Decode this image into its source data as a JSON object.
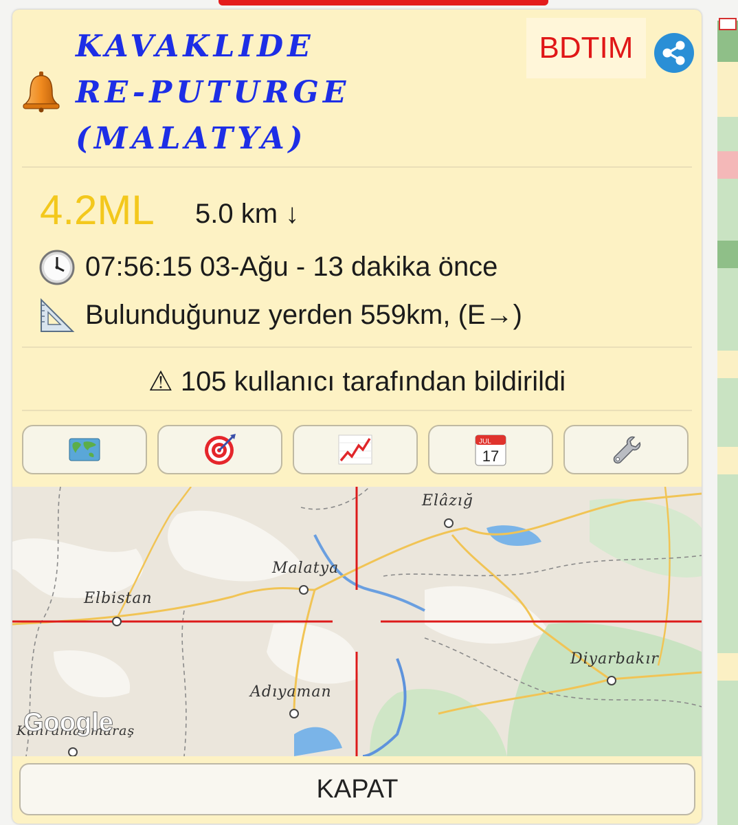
{
  "event": {
    "title_lines": [
      "KAVAKLIDE",
      "RE-PUTURGE",
      "(MALATYA)"
    ],
    "source": "BDTIM",
    "magnitude": "4.2ML",
    "depth": "5.0 km ↓",
    "time": "07:56:15 03-Ağu - 13 dakika önce",
    "distance": "Bulunduğunuz yerden 559km, (E→)",
    "reports": "⚠ 105 kullanıcı tarafından bildirildi"
  },
  "toolbar": {
    "buttons": [
      "map-icon",
      "target-icon",
      "chart-icon",
      "calendar-icon",
      "wrench-icon"
    ],
    "calendar_month": "JUL",
    "calendar_day": "17"
  },
  "map": {
    "cities": [
      "Elâzığ",
      "Malatya",
      "Elbistan",
      "Adıyaman",
      "Diyarbakır",
      "Kahramanmaraş"
    ],
    "logo": "Google"
  },
  "actions": {
    "close_label": "KAPAT"
  },
  "colors": {
    "title": "#1d2ee6",
    "source": "#e01717",
    "magnitude": "#f3c81c",
    "share": "#2a8fd6",
    "crosshair": "#dd1a1a"
  }
}
